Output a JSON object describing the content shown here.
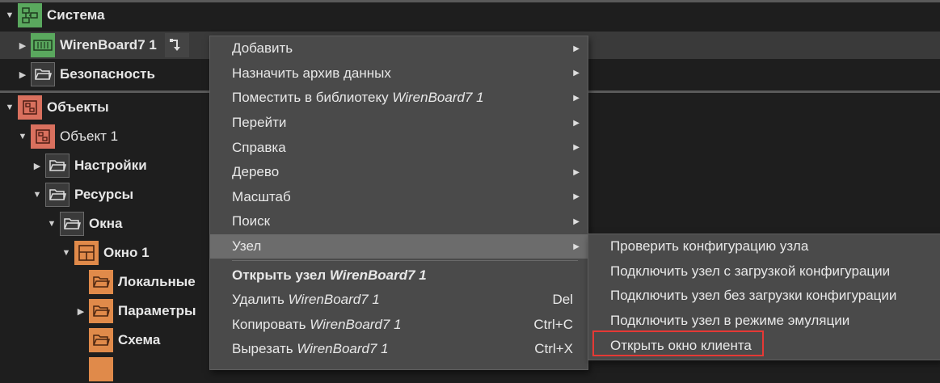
{
  "tree": {
    "system": "Система",
    "wirenboard": "WirenBoard7 1",
    "security": "Безопасность",
    "objects": "Объекты",
    "object1": "Объект 1",
    "settings": "Настройки",
    "resources": "Ресурсы",
    "windows": "Окна",
    "window1": "Окно 1",
    "local": "Локальные",
    "params": "Параметры",
    "scheme": "Схема"
  },
  "menu": {
    "add": "Добавить",
    "assign_archive": "Назначить архив данных",
    "put_library": "Поместить в библиотеку",
    "put_library_target": "WirenBoard7 1",
    "goto": "Перейти",
    "help": "Справка",
    "tree": "Дерево",
    "scale": "Масштаб",
    "search": "Поиск",
    "node": "Узел",
    "open_node": "Открыть узел",
    "open_node_target": "WirenBoard7 1",
    "delete": "Удалить",
    "delete_target": "WirenBoard7 1",
    "delete_shortcut": "Del",
    "copy": "Копировать",
    "copy_target": "WirenBoard7 1",
    "copy_shortcut": "Ctrl+C",
    "cut": "Вырезать",
    "cut_target": "WirenBoard7 1",
    "cut_shortcut": "Ctrl+X"
  },
  "submenu": {
    "check_config": "Проверить конфигурацию узла",
    "connect_with_config": "Подключить узел с загрузкой конфигурации",
    "connect_without_config": "Подключить узел без загрузки конфигурации",
    "connect_emulation": "Подключить узел в режиме эмуляции",
    "open_client": "Открыть окно клиента"
  },
  "colors": {
    "highlight_box": "#e53935",
    "system_icon": "#5aa85e",
    "objects_icon": "#d9705e",
    "folder_orange": "#e08a4a"
  }
}
